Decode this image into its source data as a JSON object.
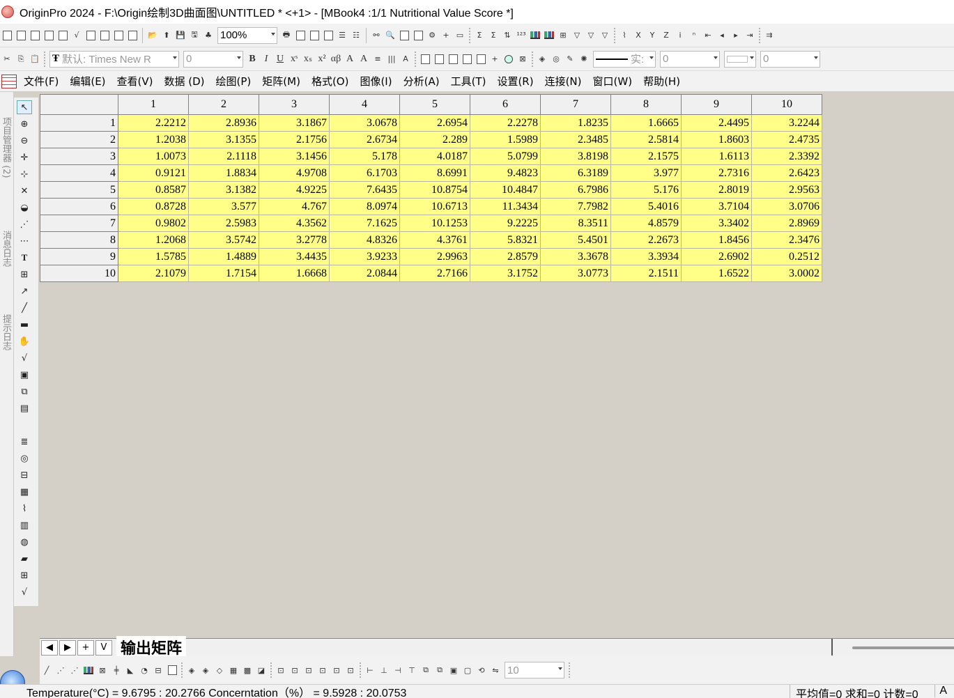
{
  "window": {
    "title": "OriginPro 2024 - F:\\Origin绘制3D曲面图\\UNTITLED * <+1> - [MBook4 :1/1 Nutritional Value Score *]"
  },
  "toolbar": {
    "zoom_value": "100%",
    "font_value": "默认: Times New R",
    "font_size_value": "0",
    "line_style_value": "实:",
    "line_width_value": "0",
    "color_value": "0",
    "bottom_combo_value": "10"
  },
  "menu": {
    "items": [
      "文件(F)",
      "编辑(E)",
      "查看(V)",
      "数据 (D)",
      "绘图(P)",
      "矩阵(M)",
      "格式(O)",
      "图像(I)",
      "分析(A)",
      "工具(T)",
      "设置(R)",
      "连接(N)",
      "窗口(W)",
      "帮助(H)"
    ]
  },
  "side_panels": {
    "tabs": [
      "项目管理器 (2)",
      "消息日志",
      "提示日志"
    ]
  },
  "matrix": {
    "column_headers": [
      "1",
      "2",
      "3",
      "4",
      "5",
      "6",
      "7",
      "8",
      "9",
      "10"
    ],
    "row_headers": [
      "1",
      "2",
      "3",
      "4",
      "5",
      "6",
      "7",
      "8",
      "9",
      "10"
    ],
    "rows": [
      [
        "2.2212",
        "2.8936",
        "3.1867",
        "3.0678",
        "2.6954",
        "2.2278",
        "1.8235",
        "1.6665",
        "2.4495",
        "3.2244"
      ],
      [
        "1.2038",
        "3.1355",
        "2.1756",
        "2.6734",
        "2.289",
        "1.5989",
        "2.3485",
        "2.5814",
        "1.8603",
        "2.4735"
      ],
      [
        "1.0073",
        "2.1118",
        "3.1456",
        "5.178",
        "4.0187",
        "5.0799",
        "3.8198",
        "2.1575",
        "1.6113",
        "2.3392"
      ],
      [
        "0.9121",
        "1.8834",
        "4.9708",
        "6.1703",
        "8.6991",
        "9.4823",
        "6.3189",
        "3.977",
        "2.7316",
        "2.6423"
      ],
      [
        "0.8587",
        "3.1382",
        "4.9225",
        "7.6435",
        "10.8754",
        "10.4847",
        "6.7986",
        "5.176",
        "2.8019",
        "2.9563"
      ],
      [
        "0.8728",
        "3.577",
        "4.767",
        "8.0974",
        "10.6713",
        "11.3434",
        "7.7982",
        "5.4016",
        "3.7104",
        "3.0706"
      ],
      [
        "0.9802",
        "2.5983",
        "4.3562",
        "7.1625",
        "10.1253",
        "9.2225",
        "8.3511",
        "4.8579",
        "3.3402",
        "2.8969"
      ],
      [
        "1.2068",
        "3.5742",
        "3.2778",
        "4.8326",
        "4.3761",
        "5.8321",
        "5.4501",
        "2.2673",
        "1.8456",
        "2.3476"
      ],
      [
        "1.5785",
        "1.4889",
        "3.4435",
        "3.9233",
        "2.9963",
        "2.8579",
        "3.3678",
        "3.3934",
        "2.6902",
        "0.2512"
      ],
      [
        "2.1079",
        "1.7154",
        "1.6668",
        "2.0844",
        "2.7166",
        "3.1752",
        "3.0773",
        "2.1511",
        "1.6522",
        "3.0002"
      ]
    ]
  },
  "sheet_tabs": {
    "nav": [
      "◀",
      "▶",
      "+",
      "V"
    ],
    "active": "输出矩阵"
  },
  "statusbar": {
    "coords": "Temperature(°C) = 9.6795 : 20.2766   Concerntation（%） = 9.5928 : 20.0753",
    "stats": "平均值=0 求和=0 计数=0",
    "mode": "A"
  },
  "colors": {
    "cell_bg": "#ffff88",
    "workspace_bg": "#d4d0c8",
    "header_bg": "#f0f0f0"
  }
}
